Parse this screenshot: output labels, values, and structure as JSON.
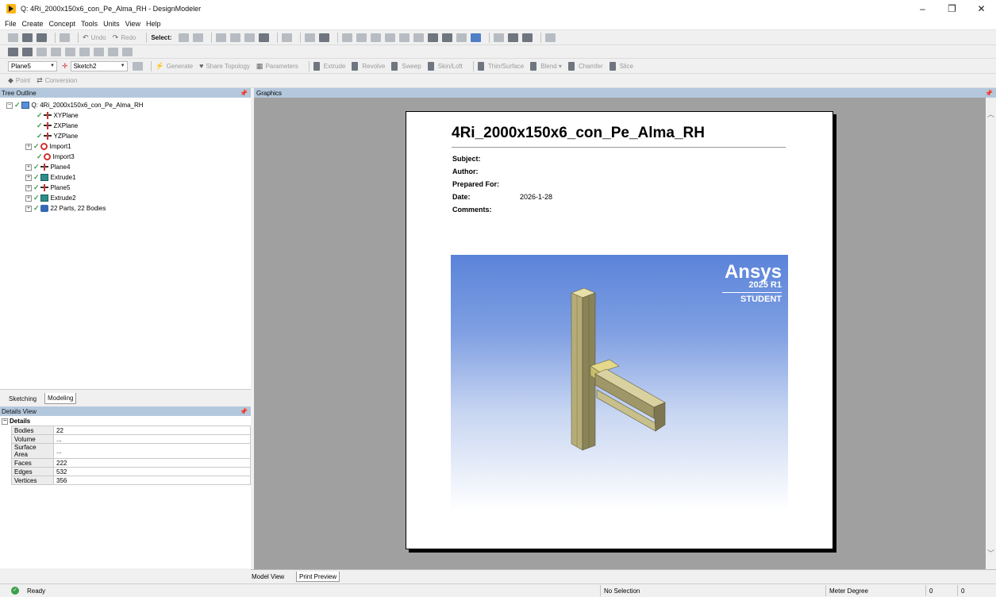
{
  "window": {
    "title": "Q: 4Ri_2000x150x6_con_Pe_Alma_RH - DesignModeler",
    "controls": {
      "minimize": "–",
      "maximize": "❐",
      "close": "✕"
    }
  },
  "menu": [
    "File",
    "Create",
    "Concept",
    "Tools",
    "Units",
    "View",
    "Help"
  ],
  "toolbar1": {
    "undo": "Undo",
    "redo": "Redo",
    "select": "Select:"
  },
  "toolbar3": {
    "plane_combo": "Plane5",
    "sketch_combo": "Sketch2",
    "generate": "Generate",
    "share_topology": "Share Topology",
    "parameters": "Parameters",
    "extrude": "Extrude",
    "revolve": "Revolve",
    "sweep": "Sweep",
    "skin_loft": "Skin/Loft",
    "thin_surface": "Thin/Surface",
    "blend": "Blend ▾",
    "chamfer": "Chamfer",
    "slice": "Slice"
  },
  "toolbar4": {
    "point": "Point",
    "conversion": "Conversion"
  },
  "tree": {
    "header": "Tree Outline",
    "pin": "⊞",
    "root": "Q: 4Ri_2000x150x6_con_Pe_Alma_RH",
    "items": [
      {
        "label": "XYPlane"
      },
      {
        "label": "ZXPlane"
      },
      {
        "label": "YZPlane"
      },
      {
        "label": "Import1"
      },
      {
        "label": "Import3"
      },
      {
        "label": "Plane4"
      },
      {
        "label": "Extrude1"
      },
      {
        "label": "Plane5"
      },
      {
        "label": "Extrude2"
      },
      {
        "label": "22 Parts, 22 Bodies"
      }
    ]
  },
  "left_tabs": {
    "sketching": "Sketching",
    "modeling": "Modeling"
  },
  "details": {
    "header": "Details View",
    "group": "Details",
    "rows": [
      {
        "key": "Bodies",
        "value": "22"
      },
      {
        "key": "Volume",
        "value": "..."
      },
      {
        "key": "Surface Area",
        "value": "..."
      },
      {
        "key": "Faces",
        "value": "222"
      },
      {
        "key": "Edges",
        "value": "532"
      },
      {
        "key": "Vertices",
        "value": "356"
      }
    ]
  },
  "graphics": {
    "header": "Graphics",
    "report": {
      "title": "4Ri_2000x150x6_con_Pe_Alma_RH",
      "fields": [
        {
          "label": "Subject:",
          "value": ""
        },
        {
          "label": "Author:",
          "value": ""
        },
        {
          "label": "Prepared For:",
          "value": ""
        },
        {
          "label": "Date:",
          "value": "2026-1-28"
        },
        {
          "label": "Comments:",
          "value": ""
        }
      ],
      "logo": {
        "word": "Ansys",
        "version": "2025 R1",
        "edition": "STUDENT"
      }
    }
  },
  "bottom_tabs": {
    "model_view": "Model View",
    "print_preview": "Print Preview"
  },
  "status": {
    "ready": "Ready",
    "selection": "No Selection",
    "units": "Meter  Degree",
    "v1": "0",
    "v2": "0"
  },
  "colors": {
    "panel_header": "#b4c8dd",
    "graphics_bg": "#a0a0a0",
    "ok_green": "#3aa048"
  }
}
